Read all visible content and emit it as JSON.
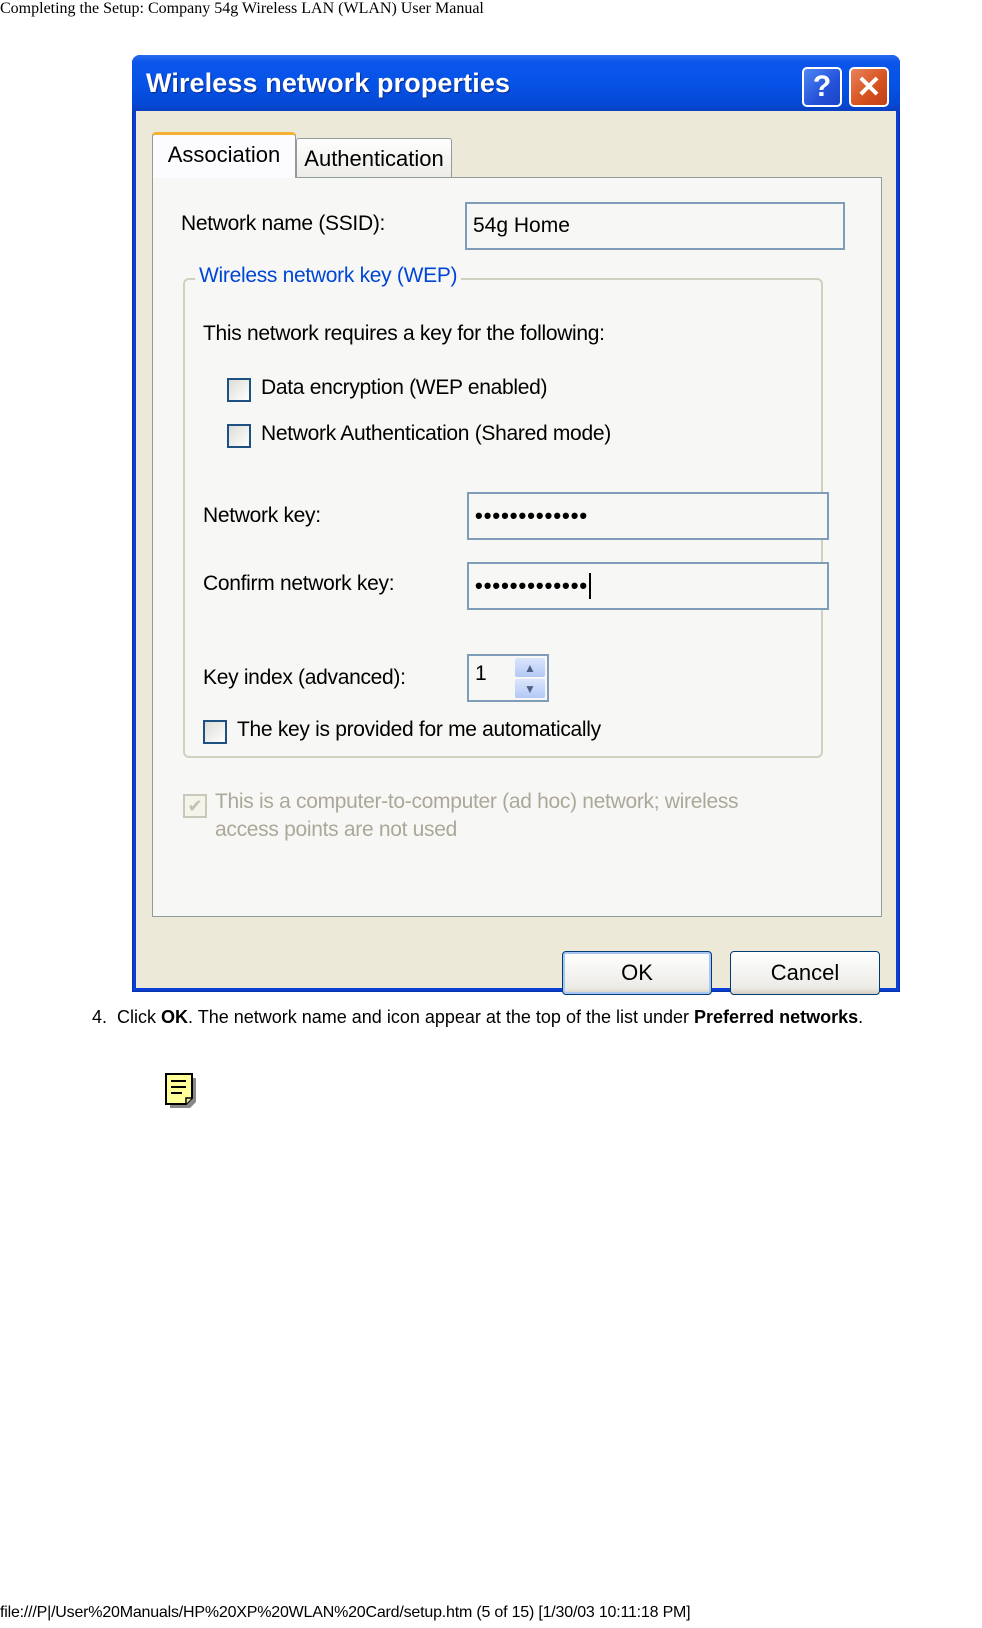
{
  "page": {
    "header": "Completing the Setup: Company 54g Wireless LAN (WLAN) User Manual",
    "footer": "file:///P|/User%20Manuals/HP%20XP%20WLAN%20Card/setup.htm (5 of 15) [1/30/03 10:11:18 PM]"
  },
  "dialog": {
    "title": "Wireless network properties",
    "help_button": "?",
    "close_button": "✕",
    "tabs": [
      {
        "label": "Association",
        "selected": true
      },
      {
        "label": "Authentication",
        "selected": false
      }
    ],
    "ssid": {
      "label": "Network name (SSID):",
      "value": "54g Home"
    },
    "wep_group": {
      "legend": "Wireless network key (WEP)",
      "intro": "This network requires a key for the following:",
      "data_encryption": {
        "label": "Data encryption (WEP enabled)",
        "checked": false
      },
      "network_auth": {
        "label": "Network Authentication (Shared mode)",
        "checked": false
      },
      "network_key": {
        "label": "Network key:",
        "value": "•••••••••••••"
      },
      "confirm_key": {
        "label": "Confirm network key:",
        "value": "•••••••••••••"
      },
      "key_index": {
        "label": "Key index (advanced):",
        "value": "1"
      },
      "auto_key": {
        "label": "The key is provided for me automatically",
        "checked": false
      }
    },
    "adhoc": {
      "line1": "This is a computer-to-computer (ad hoc) network; wireless",
      "line2": "access points are not used",
      "checked": true,
      "enabled": false
    },
    "buttons": {
      "ok": "OK",
      "cancel": "Cancel"
    }
  },
  "instruction": {
    "number": "4.",
    "pre": "Click ",
    "bold1": "OK",
    "mid": ". The network name and icon appear at the top of the list under ",
    "bold2": "Preferred networks",
    "post": "."
  },
  "note_icon": "note-icon"
}
